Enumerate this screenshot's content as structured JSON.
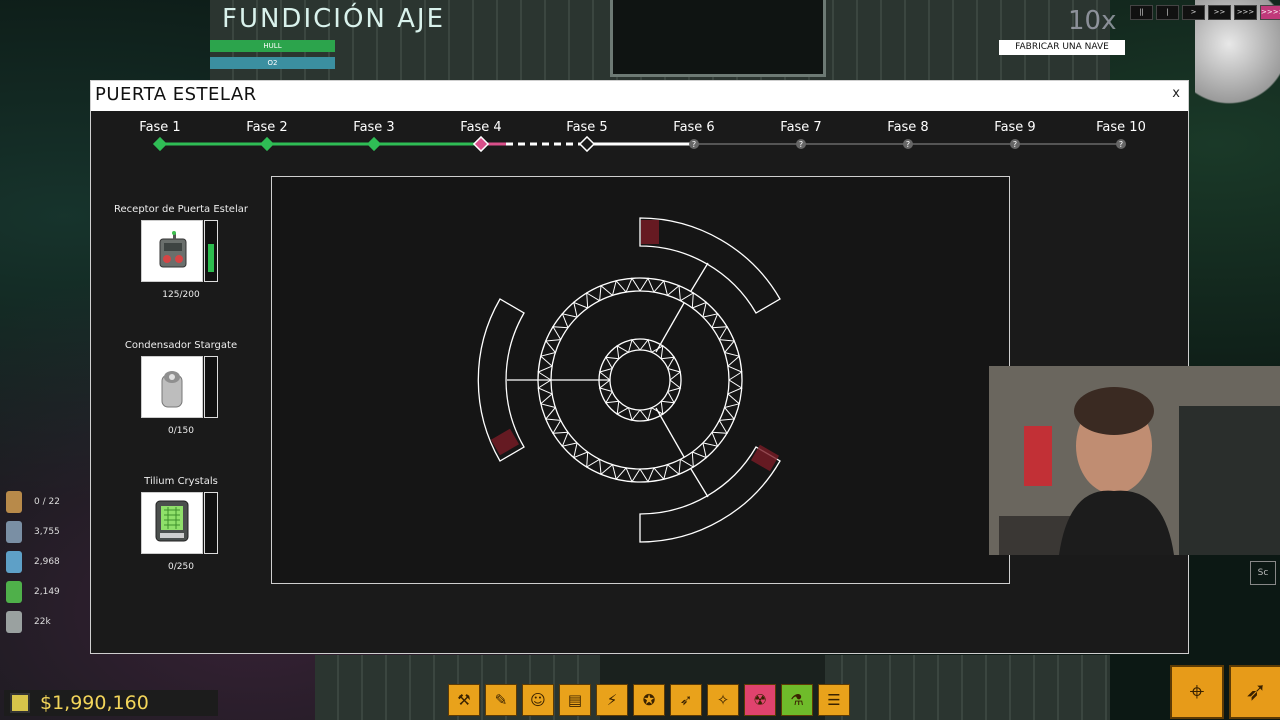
{
  "hud": {
    "station_name": "FUNDICIÓN AJE",
    "hull_label": "HULL",
    "o2_label": "O2",
    "speed": "10x",
    "speed_buttons": [
      "||",
      "|",
      ">",
      ">>",
      ">>>",
      ">>>>"
    ],
    "build_ship_button": "FABRICAR UNA NAVE",
    "stats": [
      {
        "icon": "crew-icon",
        "value": "0 / 22"
      },
      {
        "icon": "canister-icon",
        "value": "3,755"
      },
      {
        "icon": "water-icon",
        "value": "2,968"
      },
      {
        "icon": "battery-icon",
        "value": "2,149"
      },
      {
        "icon": "cargo-icon",
        "value": "22k"
      }
    ],
    "money": "$1,990,160",
    "sc_label": "Sc"
  },
  "modal": {
    "title": "PUERTA ESTELAR",
    "close_label": "x",
    "phases": [
      {
        "label": "Fase 1",
        "state": "done",
        "marker": "◆"
      },
      {
        "label": "Fase 2",
        "state": "done",
        "marker": "◆"
      },
      {
        "label": "Fase 3",
        "state": "done",
        "marker": "◆"
      },
      {
        "label": "Fase 4",
        "state": "current",
        "marker": "◆"
      },
      {
        "label": "Fase 5",
        "state": "next",
        "marker": "◇"
      },
      {
        "label": "Fase 6",
        "state": "locked",
        "marker": "?"
      },
      {
        "label": "Fase 7",
        "state": "locked",
        "marker": "?"
      },
      {
        "label": "Fase 8",
        "state": "locked",
        "marker": "?"
      },
      {
        "label": "Fase 9",
        "state": "locked",
        "marker": "?"
      },
      {
        "label": "Fase 10",
        "state": "locked",
        "marker": "?"
      }
    ],
    "resources": [
      {
        "title": "Receptor de Puerta Estelar",
        "count": "125/200",
        "fill": 0.625,
        "icon": "receiver-icon"
      },
      {
        "title": "Condensador Stargate",
        "count": "0/150",
        "fill": 0,
        "icon": "condenser-icon"
      },
      {
        "title": "Tilium Crystals",
        "count": "0/250",
        "fill": 0,
        "icon": "crystal-icon"
      }
    ]
  },
  "colors": {
    "done": "#2fbd55",
    "current": "#d94f8a",
    "accent_orange": "#e9a21b"
  }
}
